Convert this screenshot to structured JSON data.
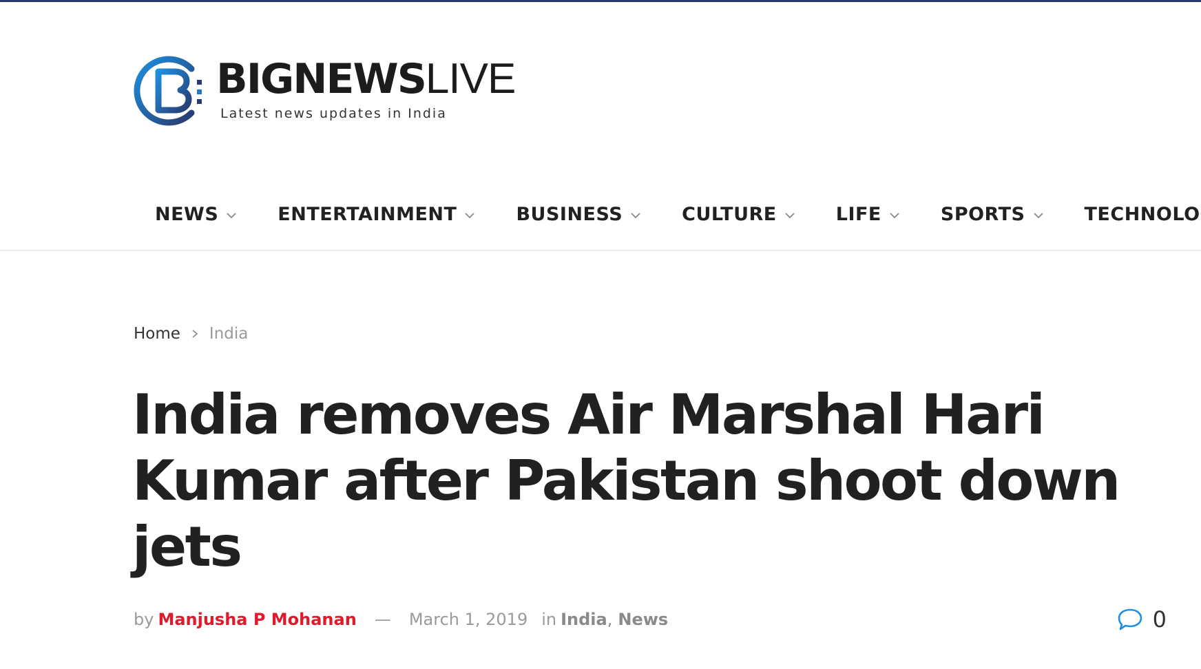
{
  "brand": {
    "name_strong": "BIGNEWS",
    "name_light": "LIVE",
    "tagline": "Latest news updates in India",
    "accent_blue": "#1e7ac4",
    "accent_dark": "#2a3a6e"
  },
  "nav": {
    "items": [
      {
        "label": "NEWS",
        "icon": "chevron-down-icon"
      },
      {
        "label": "ENTERTAINMENT",
        "icon": "chevron-down-icon"
      },
      {
        "label": "BUSINESS",
        "icon": "chevron-down-icon"
      },
      {
        "label": "CULTURE",
        "icon": "chevron-down-icon"
      },
      {
        "label": "LIFE",
        "icon": "chevron-down-icon"
      },
      {
        "label": "SPORTS",
        "icon": "chevron-down-icon"
      },
      {
        "label": "TECHNOLOG"
      }
    ]
  },
  "breadcrumb": {
    "home": "Home",
    "current": "India"
  },
  "article": {
    "title": "India removes Air Marshal Hari Kumar after Pakistan shoot down jets",
    "by_label": "by",
    "author": "Manjusha P Mohanan",
    "dash": "—",
    "date": "March 1, 2019",
    "in_label": "in",
    "categories": [
      "India",
      "News"
    ],
    "comma": ",",
    "comment_count": "0",
    "author_color": "#e01a2b",
    "comment_icon_color": "#1e8fe0"
  }
}
